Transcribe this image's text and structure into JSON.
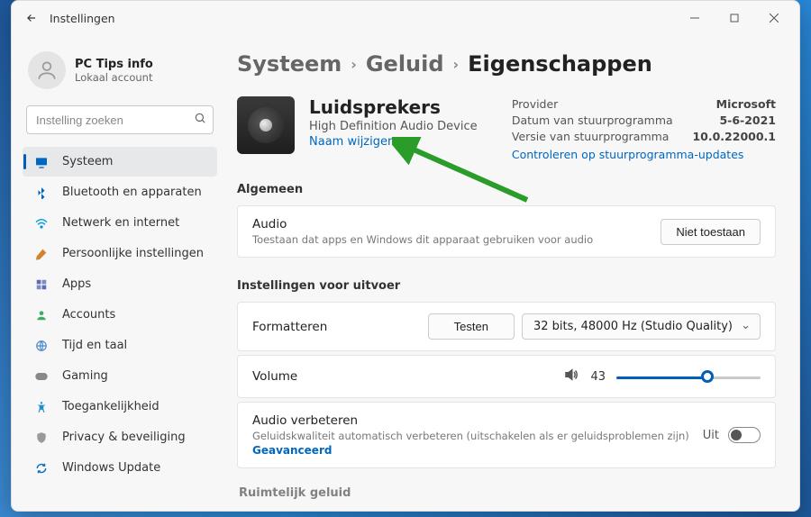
{
  "titlebar": {
    "title": "Instellingen"
  },
  "user": {
    "name": "PC Tips info",
    "subtitle": "Lokaal account"
  },
  "search": {
    "placeholder": "Instelling zoeken"
  },
  "sidebar": {
    "items": [
      {
        "label": "Systeem"
      },
      {
        "label": "Bluetooth en apparaten"
      },
      {
        "label": "Netwerk en internet"
      },
      {
        "label": "Persoonlijke instellingen"
      },
      {
        "label": "Apps"
      },
      {
        "label": "Accounts"
      },
      {
        "label": "Tijd en taal"
      },
      {
        "label": "Gaming"
      },
      {
        "label": "Toegankelijkheid"
      },
      {
        "label": "Privacy & beveiliging"
      },
      {
        "label": "Windows Update"
      }
    ]
  },
  "breadcrumb": {
    "a": "Systeem",
    "b": "Geluid",
    "c": "Eigenschappen"
  },
  "device": {
    "title": "Luidsprekers",
    "subtitle": "High Definition Audio Device",
    "rename": "Naam wijzigen",
    "meta": {
      "provider": {
        "label": "Provider",
        "value": "Microsoft"
      },
      "date": {
        "label": "Datum van stuurprogramma",
        "value": "5-6-2021"
      },
      "ver": {
        "label": "Versie van stuurprogramma",
        "value": "10.0.22000.1"
      },
      "update": "Controleren op stuurprogramma-updates"
    }
  },
  "sections": {
    "general": "Algemeen",
    "output": "Instellingen voor uitvoer"
  },
  "audio": {
    "label": "Audio",
    "desc": "Toestaan dat apps en Windows dit apparaat gebruiken voor audio",
    "btn": "Niet toestaan"
  },
  "format": {
    "label": "Formatteren",
    "test": "Testen",
    "dropdown": "32 bits, 48000 Hz (Studio Quality)"
  },
  "volume": {
    "label": "Volume",
    "value": "43",
    "pct": 63
  },
  "enhance": {
    "label": "Audio verbeteren",
    "desc": "Geluidskwaliteit automatisch verbeteren (uitschakelen als er geluidsproblemen zijn)",
    "advanced": "Geavanceerd",
    "state": "Uit"
  },
  "bottom_peek": "Ruimtelijk geluid"
}
